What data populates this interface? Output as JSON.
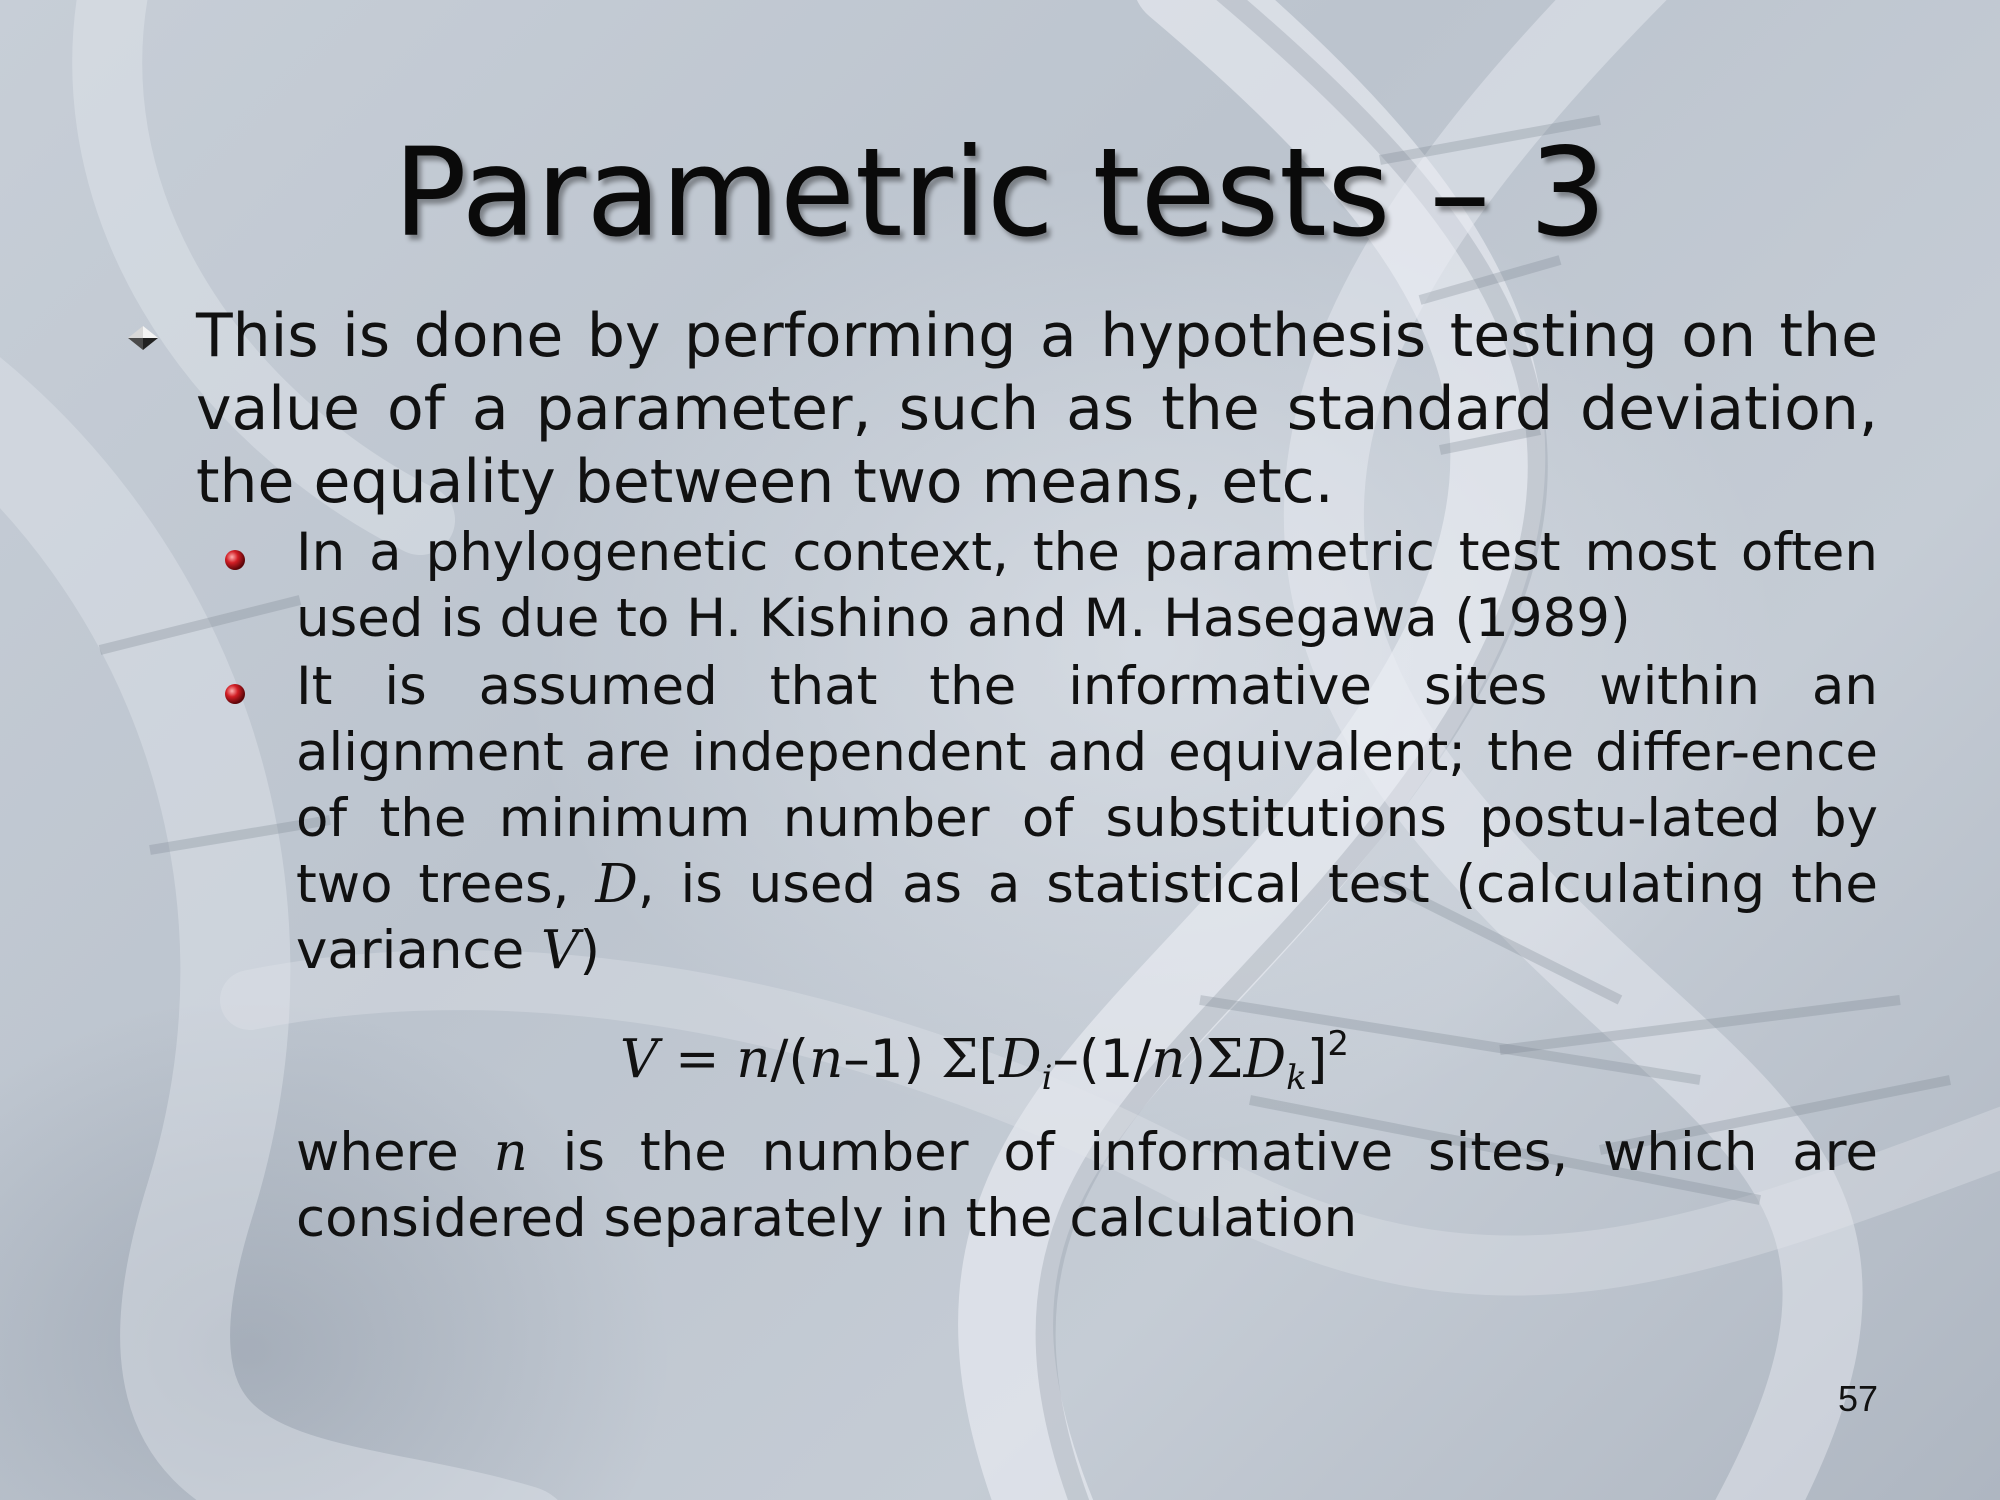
{
  "slide": {
    "title": "Parametric tests – 3",
    "main_bullet": "This is done by performing a hypothesis testing on the value of a parameter, such as the standard deviation, the equality between two means, etc.",
    "sub_bullets": [
      {
        "text": "In a phylogenetic context, the parametric test most often used is due to H. Kishino and M. Hasegawa (1989)"
      },
      {
        "text_a": "It is assumed that the informative sites within an alignment are independent and equivalent; the differ-ence of the minimum number of substitutions postu-lated by two trees, ",
        "var_d": "D",
        "text_b": ", is used as a statistical test (calculating the variance ",
        "var_v": "V",
        "text_c": ")"
      }
    ],
    "formula": {
      "lhs": "V",
      "eq": " = ",
      "n1": "n",
      "slash_open": "/(",
      "n2": "n",
      "minus_one": "–1) ",
      "sigma1": "Σ",
      "bracket_open": "[",
      "d_i": "D",
      "sub_i": "i",
      "minus_open": "–(1/",
      "n3": "n",
      "close_paren": ")",
      "sigma2": "Σ",
      "d_k": "D",
      "sub_k": "k",
      "bracket_close": "]",
      "exp": "2"
    },
    "where_text_a": "where ",
    "where_var_n": "n",
    "where_text_b": " is the number of informative sites, which are considered separately in the calculation",
    "page_number": "57"
  },
  "colors": {
    "background": "#bcc4ce",
    "text": "#111111",
    "sub_bullet_marker": "#b3161c"
  },
  "icons": {
    "main_bullet": "diamond-bullet-icon",
    "sub_bullet": "red-ball-bullet-icon"
  }
}
